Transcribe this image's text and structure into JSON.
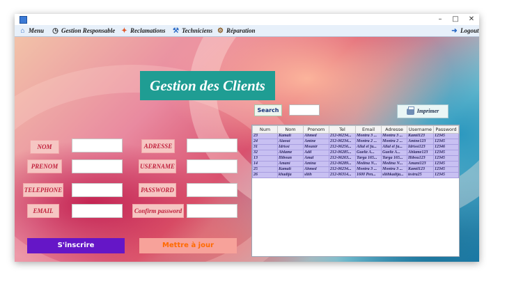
{
  "window": {
    "controls": {
      "minimize": "–",
      "maximize": "□",
      "close": "✕"
    }
  },
  "menubar": {
    "items": [
      {
        "label": "Menu",
        "icon": "home-icon"
      },
      {
        "label": "Gestion Responsable",
        "icon": "clock-icon"
      },
      {
        "label": "Reclamations",
        "icon": "reclamation-icon"
      },
      {
        "label": "Techniciens",
        "icon": "technician-icon"
      },
      {
        "label": "Réparation",
        "icon": "repair-icon"
      },
      {
        "label": "Logout",
        "icon": "logout-icon"
      }
    ]
  },
  "page": {
    "title": "Gestion des Clients"
  },
  "form": {
    "nom": "NOM",
    "prenom": "PRENOM",
    "telephone": "TELEPHONE",
    "email": "EMAIL",
    "adresse": "ADRESSE",
    "username": "USERNAME",
    "password": "PASSWORD",
    "confirm_password": "Confirm password"
  },
  "actions": {
    "inscrire": "S'inscrire",
    "mettre_a_jour": "Mettre à jour"
  },
  "search": {
    "button": "Search",
    "value": ""
  },
  "print": {
    "label": "Imprimer"
  },
  "table": {
    "columns": [
      "Num",
      "Nom",
      "Prenom",
      "Tel",
      "Email",
      "Adresse",
      "Username",
      "Password"
    ],
    "rows": [
      [
        "23",
        "Kamali",
        "Ahmed",
        "212-06234...",
        "Montra 3 ...",
        "Montra 3 ...",
        "Kamil123",
        "12345"
      ],
      [
        "24",
        "Alaoui",
        "Amine",
        "212-06234...",
        "Montra 2 ...",
        "Montra 2 ...",
        "Amine123",
        "12345"
      ],
      [
        "31",
        "Idrissi",
        "Mounir",
        "212-06256...",
        "Allal el fa...",
        "Allal el fa...",
        "Idrissi123",
        "12346"
      ],
      [
        "32",
        "Ahlame",
        "Adil",
        "212-06285...",
        "Gueliz A...",
        "Gueliz A...",
        "Ahlame123",
        "12345"
      ],
      [
        "13",
        "Hiboun",
        "Amal",
        "212-06263...",
        "Targa 165...",
        "Targa 165...",
        "Hibou123",
        "12345"
      ],
      [
        "14",
        "Amani",
        "Amina",
        "212-06289...",
        "Medina N...",
        "Medina N...",
        "Amani123",
        "12345"
      ],
      [
        "25",
        "Kamali",
        "Ahmed",
        "212-06234...",
        "Montra 3 ...",
        "Montra 3 ...",
        "Kamil123",
        "12345"
      ],
      [
        "26",
        "khadija",
        "sliih",
        "212-06314...",
        "1600 Pen...",
        "sliihkadija...",
        "testra25",
        "12345"
      ]
    ]
  }
}
